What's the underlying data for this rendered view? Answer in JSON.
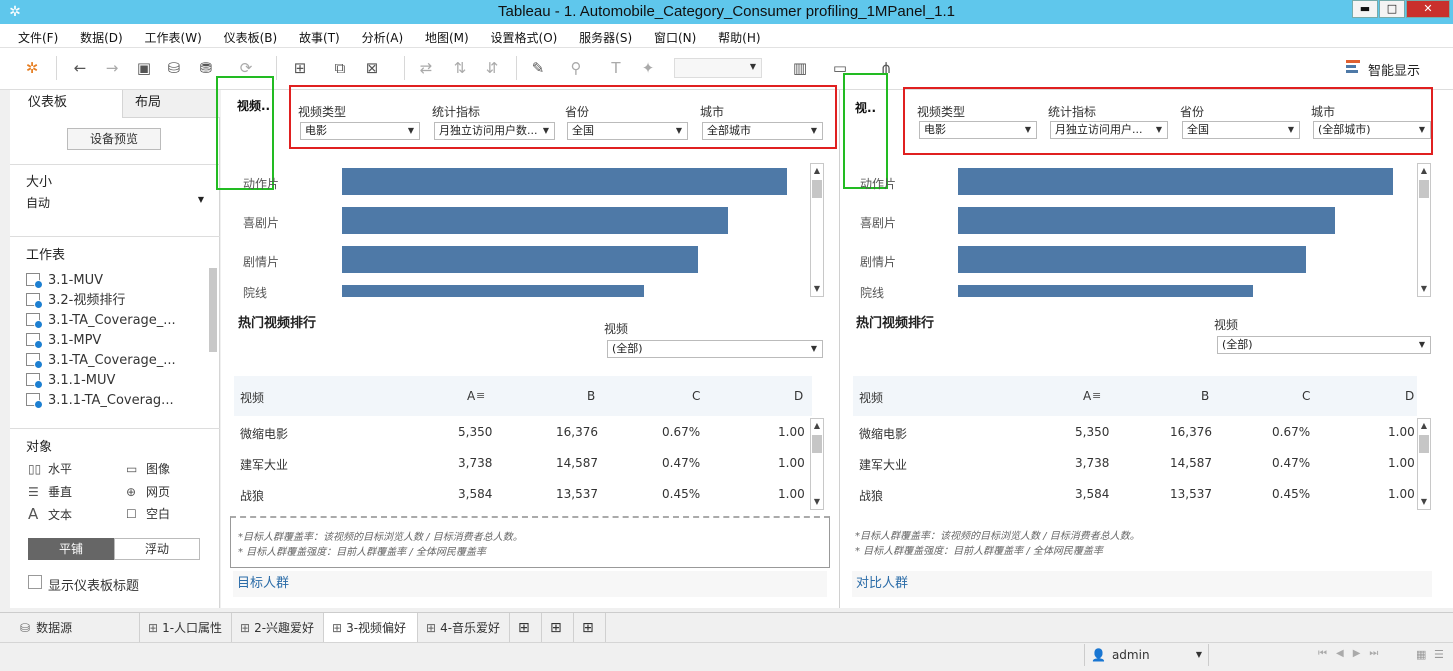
{
  "window": {
    "title": "Tableau - 1. Automobile_Category_Consumer profiling_1MPanel_1.1",
    "controls": [
      "▬",
      "□",
      "✕"
    ]
  },
  "menu": [
    "文件(F)",
    "数据(D)",
    "工作表(W)",
    "仪表板(B)",
    "故事(T)",
    "分析(A)",
    "地图(M)",
    "设置格式(O)",
    "服务器(S)",
    "窗口(N)",
    "帮助(H)"
  ],
  "toolbar": {
    "smart_display": "智能显示"
  },
  "left_panel": {
    "tabs": [
      "仪表板",
      "布局"
    ],
    "device_preview": "设备预览",
    "size": {
      "label": "大小",
      "value": "自动"
    },
    "worksheets": {
      "label": "工作表",
      "items": [
        "3.1-MUV",
        "3.2-视频排行",
        "3.1-TA_Coverage_...",
        "3.1-MPV",
        "3.1-TA_Coverage_...",
        "3.1.1-MUV",
        "3.1.1-TA_Coverag..."
      ]
    },
    "objects": {
      "label": "对象",
      "items": [
        {
          "icon": "▯▯",
          "label": "水平"
        },
        {
          "icon": "▭",
          "label": "图像"
        },
        {
          "icon": "☰",
          "label": "垂直"
        },
        {
          "icon": "⊕",
          "label": "网页"
        },
        {
          "icon": "A",
          "label": "文本"
        },
        {
          "icon": "☐",
          "label": "空白"
        }
      ]
    },
    "layout_mode": [
      "平铺",
      "浮动"
    ],
    "show_title": "显示仪表板标题"
  },
  "panels": [
    {
      "title": "视频..",
      "filters": [
        {
          "label": "视频类型",
          "value": "电影"
        },
        {
          "label": "统计指标",
          "value": "月独立访问用户数..."
        },
        {
          "label": "省份",
          "value": "全国"
        },
        {
          "label": "城市",
          "value": "全部城市"
        }
      ],
      "categories": [
        "动作片",
        "喜剧片",
        "剧情片",
        "院线"
      ],
      "bar_values": [
        1.0,
        0.86,
        0.79,
        0.68
      ],
      "section_title": "热门视频排行",
      "video_filter": {
        "label": "视频",
        "value": "(全部)"
      },
      "table": {
        "headers": [
          "视频",
          "A",
          "B",
          "C",
          "D"
        ],
        "rows": [
          [
            "微缩电影",
            "5,350",
            "16,376",
            "0.67%",
            "1.00"
          ],
          [
            "建军大业",
            "3,738",
            "14,587",
            "0.47%",
            "1.00"
          ],
          [
            "战狼",
            "3,584",
            "13,537",
            "0.45%",
            "1.00"
          ]
        ]
      },
      "notes": [
        "*目标人群覆盖率：该视频的目标浏览人数 / 目标消费者总人数。",
        "* 目标人群覆盖强度：目前人群覆盖率 / 全体网民覆盖率"
      ],
      "footer": "目标人群"
    },
    {
      "title": "视..",
      "filters": [
        {
          "label": "视频类型",
          "value": "电影"
        },
        {
          "label": "统计指标",
          "value": "月独立访问用户..."
        },
        {
          "label": "省份",
          "value": "全国"
        },
        {
          "label": "城市",
          "value": "(全部城市)"
        }
      ],
      "categories": [
        "动作片",
        "喜剧片",
        "剧情片",
        "院线"
      ],
      "bar_values": [
        1.0,
        0.87,
        0.8,
        0.69
      ],
      "section_title": "热门视频排行",
      "video_filter": {
        "label": "视频",
        "value": "(全部)"
      },
      "table": {
        "headers": [
          "视频",
          "A",
          "B",
          "C",
          "D"
        ],
        "rows": [
          [
            "微缩电影",
            "5,350",
            "16,376",
            "0.67%",
            "1.00"
          ],
          [
            "建军大业",
            "3,738",
            "14,587",
            "0.47%",
            "1.00"
          ],
          [
            "战狼",
            "3,584",
            "13,537",
            "0.45%",
            "1.00"
          ]
        ]
      },
      "notes": [
        "*目标人群覆盖率：该视频的目标浏览人数 / 目标消费者总人数。",
        "* 目标人群覆盖强度：目前人群覆盖率 / 全体网民覆盖率"
      ],
      "footer": "对比人群"
    }
  ],
  "bottom_tabs": [
    "数据源",
    "1-人口属性",
    "2-兴趣爱好",
    "3-视频偏好",
    "4-音乐爱好"
  ],
  "status": {
    "user": "admin"
  },
  "colors": {
    "bar": "#4e79a7",
    "titlebar": "#5fc7ec",
    "highlight_red": "#e02020",
    "highlight_green": "#22bb22"
  }
}
